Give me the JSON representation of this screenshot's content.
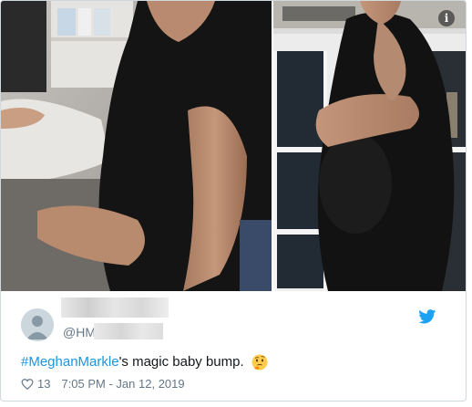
{
  "tweet": {
    "handle_prefix": "@HM",
    "hashtag": "#MeghanMarkle",
    "text_rest": "'s magic baby bump.",
    "emoji": "thinking-face-icon",
    "likes": "13",
    "timestamp": "7:05 PM - Jan 12, 2019"
  },
  "colors": {
    "hashtag": "#1b95e0",
    "meta": "#657786",
    "text": "#14171a",
    "twitter_blue": "#1da1f2",
    "border": "#cfd9de"
  },
  "icons": {
    "info": "info-icon",
    "brand": "twitter-bird-icon",
    "like": "heart-icon"
  }
}
